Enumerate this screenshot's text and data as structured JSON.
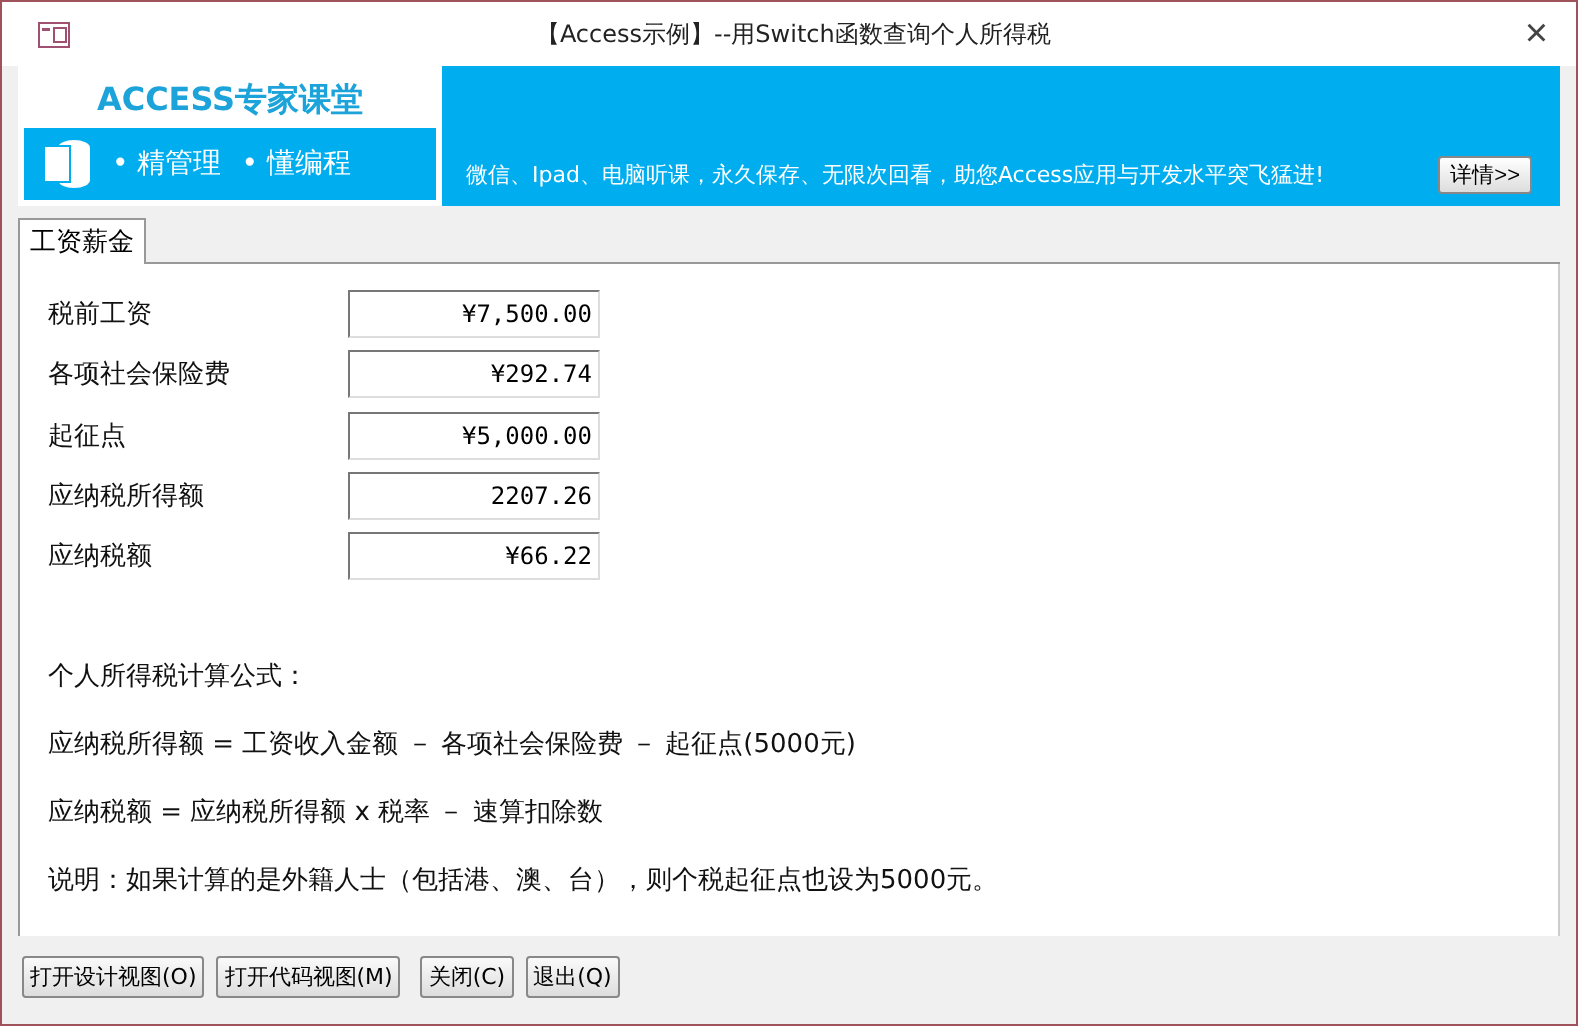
{
  "window": {
    "title": "【Access示例】--用Switch函数查询个人所得税",
    "close": "×"
  },
  "banner": {
    "title": "ACCESS专家课堂",
    "slogan_1": "• 精管理",
    "slogan_2": "• 懂编程",
    "text": "微信、Ipad、电脑听课，永久保存、无限次回看，助您Access应用与开发水平突飞猛进!",
    "button": "详情>>"
  },
  "tabs": [
    {
      "label": "工资薪金",
      "selected": true
    }
  ],
  "fields": [
    {
      "label": "税前工资",
      "value": "¥7,500.00"
    },
    {
      "label": "各项社会保险费",
      "value": "¥292.74"
    },
    {
      "label": "起征点",
      "value": "¥5,000.00"
    },
    {
      "label": "应纳税所得额",
      "value": "2207.26"
    },
    {
      "label": "应纳税额",
      "value": "¥66.22"
    }
  ],
  "notes": [
    "个人所得税计算公式：",
    "应纳税所得额 = 工资收入金额 － 各项社会保险费 － 起征点(5000元)",
    "应纳税额 = 应纳税所得额 x 税率 － 速算扣除数",
    "说明：如果计算的是外籍人士（包括港、澳、台），则个税起征点也设为5000元。"
  ],
  "buttons": [
    "打开设计视图(O)",
    "打开代码视图(M)",
    "关闭(C)",
    "退出(Q)"
  ]
}
